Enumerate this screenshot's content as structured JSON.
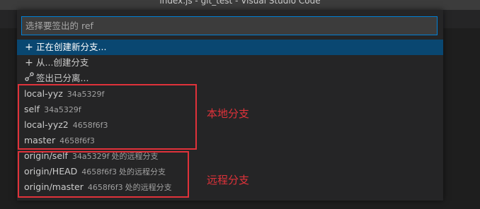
{
  "window": {
    "title": "index.js - git_test - Visual Studio Code"
  },
  "quick_pick": {
    "placeholder": "选择要签出的 ref",
    "value": "",
    "actions": [
      {
        "icon": "plus-icon",
        "glyph": "+",
        "label": "正在创建新分支...",
        "selected": true
      },
      {
        "icon": "plus-icon",
        "glyph": "+",
        "label": "从...创建分支",
        "selected": false
      },
      {
        "icon": "detach-icon",
        "glyph": "⌀",
        "label": "签出已分离...",
        "selected": false
      }
    ],
    "local_branches": [
      {
        "name": "local-yyz",
        "commit": "34a5329f"
      },
      {
        "name": "self",
        "commit": "34a5329f"
      },
      {
        "name": "local-yyz2",
        "commit": "4658f6f3"
      },
      {
        "name": "master",
        "commit": "4658f6f3"
      }
    ],
    "remote_branches": [
      {
        "name": "origin/self",
        "commit": "34a5329f",
        "note": "处的远程分支"
      },
      {
        "name": "origin/HEAD",
        "commit": "4658f6f3",
        "note": "处的远程分支"
      },
      {
        "name": "origin/master",
        "commit": "4658f6f3",
        "note": "处的远程分支"
      }
    ]
  },
  "annotations": {
    "local_label": "本地分支",
    "remote_label": "远程分支",
    "color": "#e0323a"
  },
  "colors": {
    "selection": "#094771",
    "focus_border": "#007fd4"
  }
}
